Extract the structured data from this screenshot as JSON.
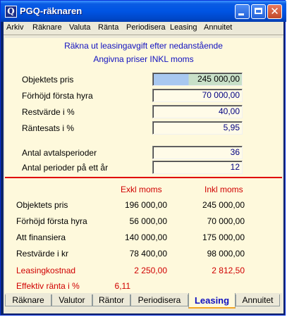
{
  "window": {
    "title": "PGQ-räknaren",
    "icon_glyph": "Q",
    "buttons": {
      "minimize": "minimize-icon",
      "maximize": "maximize-icon",
      "close_glyph": "✕"
    }
  },
  "menu": [
    "Arkiv",
    "Räknare",
    "Valuta",
    "Ränta",
    "Periodisera",
    "Leasing",
    "Annuitet"
  ],
  "header": {
    "line1": "Räkna ut leasingavgift efter nedanstående",
    "line2": "Angivna priser INKL moms"
  },
  "inputs": [
    {
      "label": "Objektets pris",
      "value": "245 000,00"
    },
    {
      "label": "Förhöjd första hyra",
      "value": "70 000,00"
    },
    {
      "label": "Restvärde i %",
      "value": "40,00"
    },
    {
      "label": "Räntesats i %",
      "value": "5,95"
    },
    {
      "label": "Antal avtalsperioder",
      "value": "36"
    },
    {
      "label": "Antal perioder på ett år",
      "value": "12"
    }
  ],
  "results": {
    "col_exkl": "Exkl moms",
    "col_inkl": "Inkl moms",
    "rows": [
      {
        "label": "Objektets pris",
        "exkl": "196 000,00",
        "inkl": "245 000,00"
      },
      {
        "label": "Förhöjd första hyra",
        "exkl": "56 000,00",
        "inkl": "70 000,00"
      },
      {
        "label": "Att finansiera",
        "exkl": "140 000,00",
        "inkl": "175 000,00"
      },
      {
        "label": "Restvärde i kr",
        "exkl": "78 400,00",
        "inkl": "98 000,00"
      }
    ],
    "leasing": {
      "label": "Leasingkostnad",
      "exkl": "2 250,00",
      "inkl": "2 812,50"
    },
    "effektiv": {
      "label": "Effektiv ränta i %",
      "value": "6,11"
    }
  },
  "tabs": [
    {
      "label": "Räknare",
      "active": false
    },
    {
      "label": "Valutor",
      "active": false
    },
    {
      "label": "Räntor",
      "active": false
    },
    {
      "label": "Periodisera",
      "active": false
    },
    {
      "label": "Leasing",
      "active": true
    },
    {
      "label": "Annuitet",
      "active": false
    }
  ],
  "colors": {
    "accent_red": "#d00000",
    "accent_blue": "#1010c0",
    "panel_bg": "#fef9dc"
  }
}
